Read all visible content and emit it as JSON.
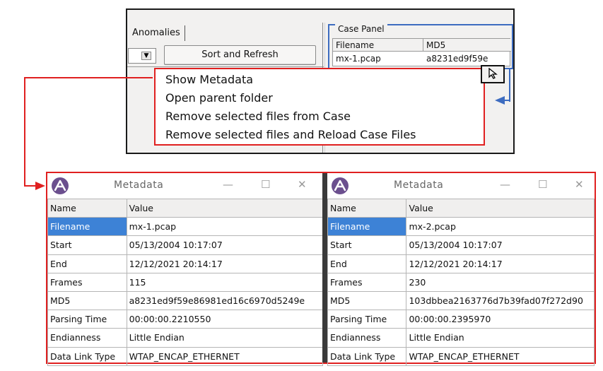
{
  "app": {
    "tab_label": "Anomalies",
    "sort_button": "Sort and Refresh",
    "case_panel": {
      "title": "Case Panel",
      "columns": [
        "Filename",
        "MD5"
      ],
      "row": {
        "filename": "mx-1.pcap",
        "md5": "a8231ed9f59e"
      }
    },
    "context_menu": [
      "Show Metadata",
      "Open parent folder",
      "Remove selected files from Case",
      "Remove selected files and Reload Case Files"
    ]
  },
  "colors": {
    "highlight_red": "#e02020",
    "case_blue": "#3d6cc0",
    "selection_blue": "#3d82d6"
  },
  "windows": [
    {
      "title": "Metadata",
      "columns": [
        "Name",
        "Value"
      ],
      "rows": [
        [
          "Filename",
          "mx-1.pcap"
        ],
        [
          "Start",
          "05/13/2004 10:17:07"
        ],
        [
          "End",
          "12/12/2021 20:14:17"
        ],
        [
          "Frames",
          "115"
        ],
        [
          "MD5",
          "a8231ed9f59e86981ed16c6970d5249e"
        ],
        [
          "Parsing Time",
          "00:00:00.2210550"
        ],
        [
          "Endianness",
          "Little Endian"
        ],
        [
          "Data Link Type",
          "WTAP_ENCAP_ETHERNET"
        ]
      ]
    },
    {
      "title": "Metadata",
      "columns": [
        "Name",
        "Value"
      ],
      "rows": [
        [
          "Filename",
          "mx-2.pcap"
        ],
        [
          "Start",
          "05/13/2004 10:17:07"
        ],
        [
          "End",
          "12/12/2021 20:14:17"
        ],
        [
          "Frames",
          "230"
        ],
        [
          "MD5",
          "103dbbea2163776d7b39fad07f272d90"
        ],
        [
          "Parsing Time",
          "00:00:00.2395970"
        ],
        [
          "Endianness",
          "Little Endian"
        ],
        [
          "Data Link Type",
          "WTAP_ENCAP_ETHERNET"
        ]
      ]
    }
  ],
  "window_buttons": {
    "minimize": "—",
    "maximize": "☐",
    "close": "✕"
  },
  "icons": {
    "app_logo": "app-logo-icon",
    "cursor": "mouse-cursor-icon",
    "dropdown": "chevron-down-icon"
  }
}
